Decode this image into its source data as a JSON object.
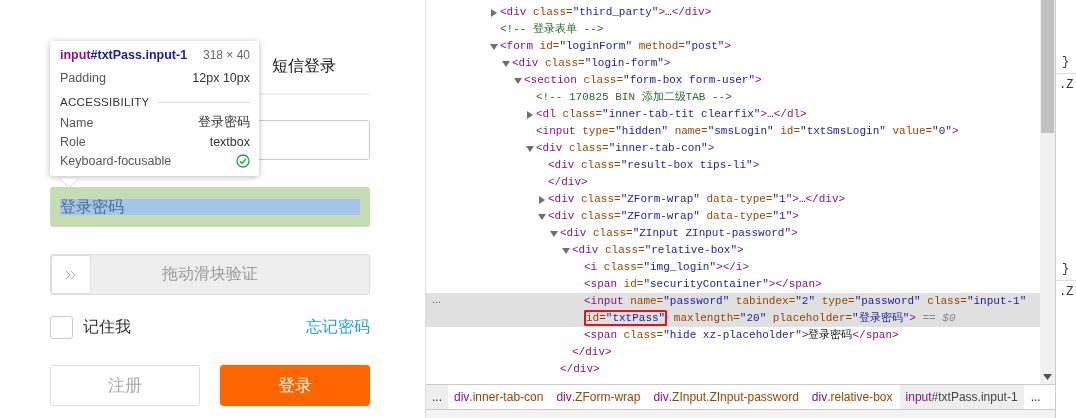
{
  "login": {
    "tabs": [
      {
        "label": "短信登录",
        "selected": false
      }
    ],
    "password_field": {
      "placeholder": "登录密码"
    },
    "slider": {
      "label": "拖动滑块验证",
      "level": 0
    },
    "remember": {
      "label": "记住我",
      "checked": false
    },
    "forgot_link": "忘记密码",
    "buttons": [
      {
        "label": "注册",
        "primary": false
      },
      {
        "label": "登录",
        "primary": true
      }
    ]
  },
  "tooltip": {
    "element_tag": "input",
    "element_rest": "#txtPass.input-1",
    "size": "318 × 40",
    "rows": [
      {
        "label": "Padding",
        "value": "12px 10px"
      }
    ],
    "section": "ACCESSIBILITY",
    "a11y": [
      {
        "label": "Name",
        "value": "登录密码"
      },
      {
        "label": "Role",
        "value": "textbox"
      }
    ],
    "focusable_label": "Keyboard-focusable",
    "keyboard_focusable": true
  },
  "dom": {
    "selection_menu": "...",
    "nodes": [
      {
        "kind": "branch",
        "expanded": false,
        "selected": false,
        "lines": [
          [
            {
              "kind": "tag",
              "text": "<div"
            },
            {
              "kind": "attr",
              "text": " class="
            },
            {
              "kind": "value",
              "text": "\"third_party\""
            },
            {
              "kind": "tag",
              "text": ">"
            },
            {
              "kind": "text",
              "text": "…"
            },
            {
              "kind": "tag",
              "text": "</div>"
            }
          ]
        ]
      },
      {
        "kind": "leaf",
        "selected": false,
        "lines": [
          [
            {
              "kind": "comment",
              "text": "<!-- 登录表单 -->"
            }
          ]
        ]
      },
      {
        "kind": "branch",
        "expanded": true,
        "selected": false,
        "lines": [
          [
            {
              "kind": "tag",
              "text": "<form"
            },
            {
              "kind": "attr",
              "text": " id="
            },
            {
              "kind": "value",
              "text": "\"loginForm\""
            },
            {
              "kind": "attr",
              "text": " method="
            },
            {
              "kind": "value",
              "text": "\"post\""
            },
            {
              "kind": "tag",
              "text": ">"
            }
          ]
        ],
        "children": [
          {
            "kind": "branch",
            "expanded": true,
            "selected": false,
            "lines": [
              [
                {
                  "kind": "tag",
                  "text": "<div"
                },
                {
                  "kind": "attr",
                  "text": " class="
                },
                {
                  "kind": "value",
                  "text": "\"login-form\""
                },
                {
                  "kind": "tag",
                  "text": ">"
                }
              ]
            ],
            "children": [
              {
                "kind": "branch",
                "expanded": true,
                "selected": false,
                "lines": [
                  [
                    {
                      "kind": "tag",
                      "text": "<section"
                    },
                    {
                      "kind": "attr",
                      "text": " class="
                    },
                    {
                      "kind": "value",
                      "text": "\"form-box form-user\""
                    },
                    {
                      "kind": "tag",
                      "text": ">"
                    }
                  ]
                ],
                "children": [
                  {
                    "kind": "leaf",
                    "selected": false,
                    "lines": [
                      [
                        {
                          "kind": "comment",
                          "text": "<!-- 170825 BIN 添加二级TAB -->"
                        }
                      ]
                    ]
                  },
                  {
                    "kind": "branch",
                    "expanded": false,
                    "selected": false,
                    "lines": [
                      [
                        {
                          "kind": "tag",
                          "text": "<dl"
                        },
                        {
                          "kind": "attr",
                          "text": " class="
                        },
                        {
                          "kind": "value",
                          "text": "\"inner-tab-tit clearfix\""
                        },
                        {
                          "kind": "tag",
                          "text": ">"
                        },
                        {
                          "kind": "text",
                          "text": "…"
                        },
                        {
                          "kind": "tag",
                          "text": "</dl>"
                        }
                      ]
                    ]
                  },
                  {
                    "kind": "leaf",
                    "selected": false,
                    "lines": [
                      [
                        {
                          "kind": "tag",
                          "text": "<input"
                        },
                        {
                          "kind": "attr",
                          "text": " type="
                        },
                        {
                          "kind": "value",
                          "text": "\"hidden\""
                        },
                        {
                          "kind": "attr",
                          "text": " name="
                        },
                        {
                          "kind": "value",
                          "text": "\"smsLogin\""
                        },
                        {
                          "kind": "attr",
                          "text": " id="
                        },
                        {
                          "kind": "value",
                          "text": "\"txtSmsLogin\""
                        },
                        {
                          "kind": "attr",
                          "text": " value="
                        },
                        {
                          "kind": "value",
                          "text": "\"0\""
                        },
                        {
                          "kind": "tag",
                          "text": ">"
                        }
                      ]
                    ]
                  },
                  {
                    "kind": "branch",
                    "expanded": true,
                    "selected": false,
                    "lines": [
                      [
                        {
                          "kind": "tag",
                          "text": "<div"
                        },
                        {
                          "kind": "attr",
                          "text": " class="
                        },
                        {
                          "kind": "value",
                          "text": "\"inner-tab-con\""
                        },
                        {
                          "kind": "tag",
                          "text": ">"
                        }
                      ]
                    ],
                    "children": [
                      {
                        "kind": "leaf",
                        "selected": false,
                        "lines": [
                          [
                            {
                              "kind": "tag",
                              "text": "<div"
                            },
                            {
                              "kind": "attr",
                              "text": " class="
                            },
                            {
                              "kind": "value",
                              "text": "\"result-box tips-li\""
                            },
                            {
                              "kind": "tag",
                              "text": ">"
                            }
                          ]
                        ],
                        "close": [
                          {
                            "kind": "tag",
                            "text": "</div>"
                          }
                        ]
                      },
                      {
                        "kind": "branch",
                        "expanded": false,
                        "selected": false,
                        "lines": [
                          [
                            {
                              "kind": "tag",
                              "text": "<div"
                            },
                            {
                              "kind": "attr",
                              "text": " class="
                            },
                            {
                              "kind": "value",
                              "text": "\"ZForm-wrap\""
                            },
                            {
                              "kind": "attr",
                              "text": " data-type="
                            },
                            {
                              "kind": "value",
                              "text": "\"1\""
                            },
                            {
                              "kind": "tag",
                              "text": ">"
                            },
                            {
                              "kind": "text",
                              "text": "…"
                            },
                            {
                              "kind": "tag",
                              "text": "</div>"
                            }
                          ]
                        ]
                      },
                      {
                        "kind": "branch",
                        "expanded": true,
                        "selected": false,
                        "lines": [
                          [
                            {
                              "kind": "tag",
                              "text": "<div"
                            },
                            {
                              "kind": "attr",
                              "text": " class="
                            },
                            {
                              "kind": "value",
                              "text": "\"ZForm-wrap\""
                            },
                            {
                              "kind": "attr",
                              "text": " data-type="
                            },
                            {
                              "kind": "value",
                              "text": "\"1\""
                            },
                            {
                              "kind": "tag",
                              "text": ">"
                            }
                          ]
                        ],
                        "children": [
                          {
                            "kind": "branch",
                            "expanded": true,
                            "selected": false,
                            "lines": [
                              [
                                {
                                  "kind": "tag",
                                  "text": "<div"
                                },
                                {
                                  "kind": "attr",
                                  "text": " class="
                                },
                                {
                                  "kind": "value",
                                  "text": "\"ZInput ZInput-password\""
                                },
                                {
                                  "kind": "tag",
                                  "text": ">"
                                }
                              ]
                            ],
                            "close": [
                              {
                                "kind": "tag",
                                "text": "</div>"
                              }
                            ],
                            "children": [
                              {
                                "kind": "branch",
                                "expanded": true,
                                "selected": false,
                                "lines": [
                                  [
                                    {
                                      "kind": "tag",
                                      "text": "<div"
                                    },
                                    {
                                      "kind": "attr",
                                      "text": " class="
                                    },
                                    {
                                      "kind": "value",
                                      "text": "\"relative-box\""
                                    },
                                    {
                                      "kind": "tag",
                                      "text": ">"
                                    }
                                  ]
                                ],
                                "close": [
                                  {
                                    "kind": "tag",
                                    "text": "</div>"
                                  }
                                ],
                                "children": [
                                  {
                                    "kind": "leaf",
                                    "selected": false,
                                    "lines": [
                                      [
                                        {
                                          "kind": "tag",
                                          "text": "<i"
                                        },
                                        {
                                          "kind": "attr",
                                          "text": " class="
                                        },
                                        {
                                          "kind": "value",
                                          "text": "\"img_login\""
                                        },
                                        {
                                          "kind": "tag",
                                          "text": "></i>"
                                        }
                                      ]
                                    ]
                                  },
                                  {
                                    "kind": "leaf",
                                    "selected": false,
                                    "lines": [
                                      [
                                        {
                                          "kind": "tag",
                                          "text": "<span"
                                        },
                                        {
                                          "kind": "attr",
                                          "text": " id="
                                        },
                                        {
                                          "kind": "value",
                                          "text": "\"securityContainer\""
                                        },
                                        {
                                          "kind": "tag",
                                          "text": "></span>"
                                        }
                                      ]
                                    ]
                                  },
                                  {
                                    "kind": "leaf",
                                    "selected": true,
                                    "lines": [
                                      [
                                        {
                                          "kind": "tag",
                                          "text": "<input"
                                        },
                                        {
                                          "kind": "attr",
                                          "text": " name="
                                        },
                                        {
                                          "kind": "value",
                                          "text": "\"password\""
                                        },
                                        {
                                          "kind": "attr",
                                          "text": " tabindex="
                                        },
                                        {
                                          "kind": "value",
                                          "text": "\"2\""
                                        },
                                        {
                                          "kind": "attr",
                                          "text": " type="
                                        },
                                        {
                                          "kind": "value",
                                          "text": "\"password\""
                                        },
                                        {
                                          "kind": "attr",
                                          "text": " class="
                                        },
                                        {
                                          "kind": "value",
                                          "text": "\"input-1\""
                                        }
                                      ],
                                      [
                                        {
                                          "kind": "attr",
                                          "text": "id=",
                                          "boxed": true
                                        },
                                        {
                                          "kind": "value",
                                          "text": "\"txtPass\"",
                                          "boxed": true
                                        },
                                        {
                                          "kind": "attr",
                                          "text": " maxlength="
                                        },
                                        {
                                          "kind": "value",
                                          "text": "\"20\""
                                        },
                                        {
                                          "kind": "attr",
                                          "text": " placeholder="
                                        },
                                        {
                                          "kind": "value",
                                          "text": "\"登录密码\""
                                        },
                                        {
                                          "kind": "tag",
                                          "text": ">"
                                        },
                                        {
                                          "kind": "console",
                                          "text": " == $0"
                                        }
                                      ]
                                    ]
                                  },
                                  {
                                    "kind": "leaf",
                                    "selected": false,
                                    "lines": [
                                      [
                                        {
                                          "kind": "tag",
                                          "text": "<span"
                                        },
                                        {
                                          "kind": "attr",
                                          "text": " class="
                                        },
                                        {
                                          "kind": "value",
                                          "text": "\"hide xz-placeholder\""
                                        },
                                        {
                                          "kind": "tag",
                                          "text": ">"
                                        },
                                        {
                                          "kind": "text",
                                          "text": "登录密码"
                                        },
                                        {
                                          "kind": "tag",
                                          "text": "</span>"
                                        }
                                      ]
                                    ]
                                  }
                                ]
                              }
                            ]
                          }
                        ]
                      }
                    ]
                  }
                ]
              }
            ]
          }
        ]
      }
    ]
  },
  "breadcrumbs": {
    "overflow_left": "...",
    "overflow_right": "...",
    "items": [
      {
        "tag": "div",
        "rest": ".inner-tab-con",
        "selected": false
      },
      {
        "tag": "div",
        "rest": ".ZForm-wrap",
        "selected": false
      },
      {
        "tag": "div",
        "rest": ".ZInput.ZInput-password",
        "selected": false
      },
      {
        "tag": "div",
        "rest": ".relative-box",
        "selected": false
      },
      {
        "tag": "input",
        "rest": "#txtPass.input-1",
        "selected": true
      }
    ]
  },
  "styles_fragments": [
    {
      "close": "}",
      "selector": ".Z"
    },
    {
      "close": "}",
      "selector": ".Z"
    }
  ]
}
